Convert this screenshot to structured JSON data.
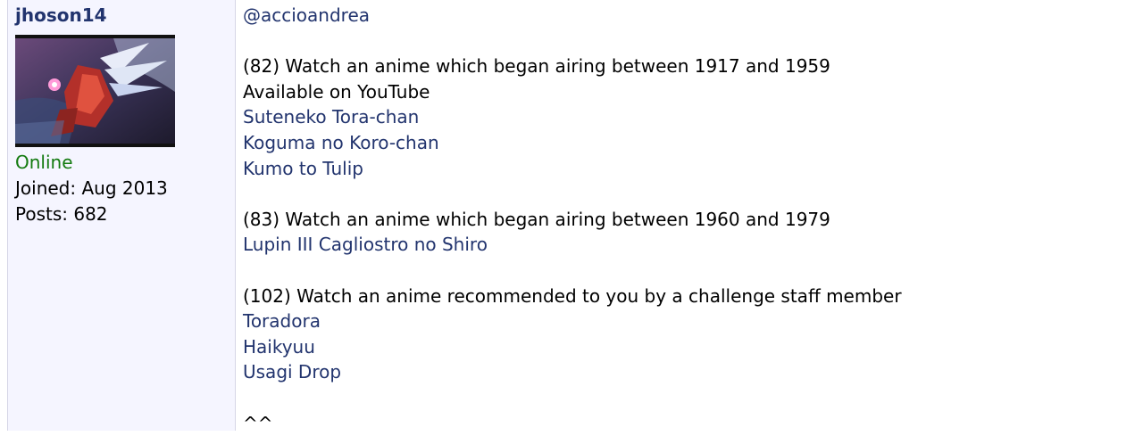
{
  "author": {
    "username": "jhoson14",
    "avatar_icon": "anime-mecha-avatar",
    "status": "Online",
    "joined": "Joined: Aug 2013",
    "posts": "Posts: 682"
  },
  "post": {
    "mention": "@accioandrea",
    "challenge_82": {
      "heading": "(82) Watch an anime which began airing between 1917 and 1959",
      "note": "Available on YouTube",
      "links": [
        "Suteneko Tora-chan",
        "Koguma no Koro-chan",
        "Kumo to Tulip"
      ]
    },
    "challenge_83": {
      "heading": "(83) Watch an anime which began airing between 1960 and 1979",
      "links": [
        "Lupin III Cagliostro no Shiro"
      ]
    },
    "challenge_102": {
      "heading": "(102) Watch an anime recommended to you by a challenge staff member",
      "links": [
        "Toradora",
        "Haikyuu",
        "Usagi Drop"
      ]
    },
    "footer": "^^"
  },
  "colors": {
    "link": "#22346e",
    "online": "#137a10",
    "sidebar_bg": "#f5f5ff"
  }
}
